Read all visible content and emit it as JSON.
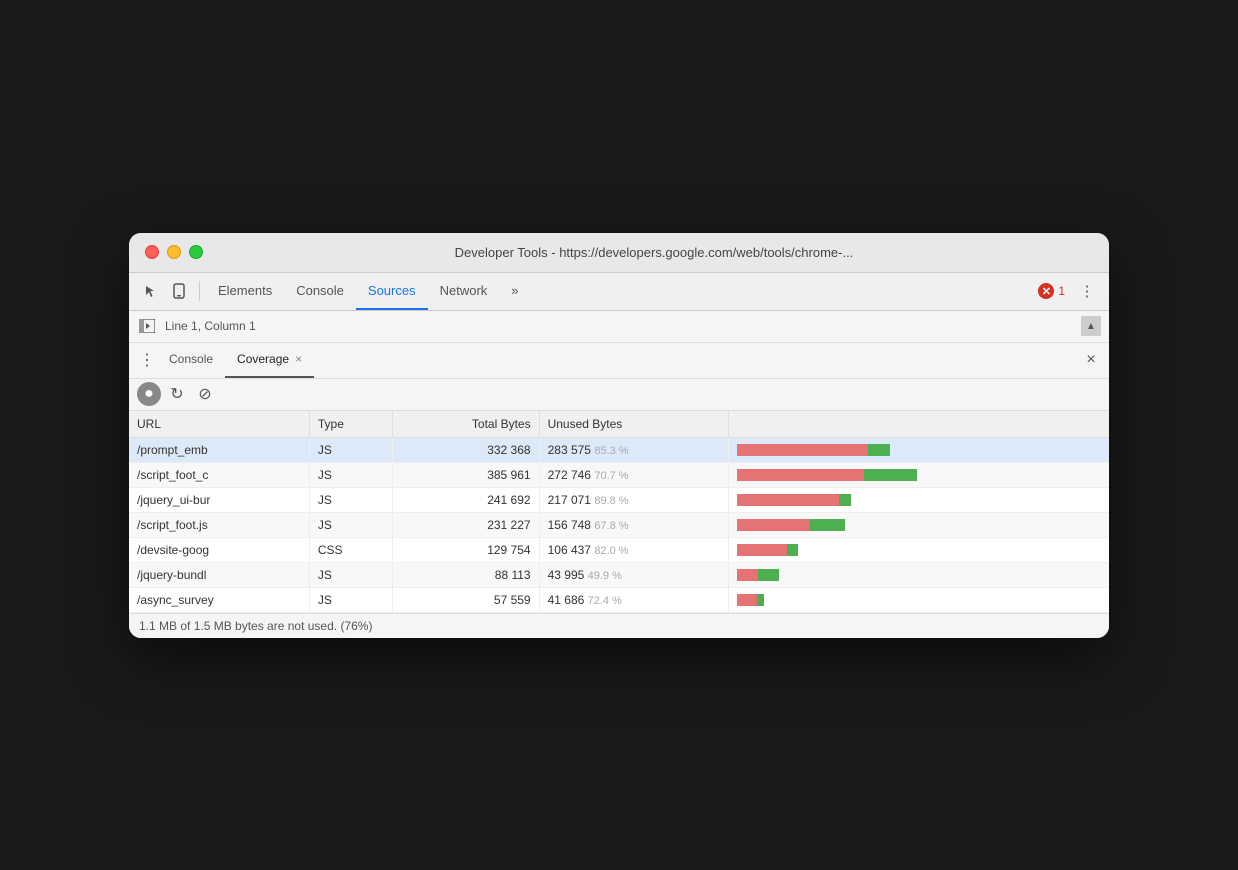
{
  "window": {
    "title": "Developer Tools - https://developers.google.com/web/tools/chrome-...",
    "traffic_lights": [
      "close",
      "minimize",
      "maximize"
    ]
  },
  "devtools": {
    "tabs": [
      {
        "id": "elements",
        "label": "Elements",
        "active": false
      },
      {
        "id": "console",
        "label": "Console",
        "active": false
      },
      {
        "id": "sources",
        "label": "Sources",
        "active": true
      },
      {
        "id": "network",
        "label": "Network",
        "active": false
      },
      {
        "id": "more",
        "label": "»",
        "active": false
      }
    ],
    "error_count": "1",
    "status_line": "Line 1, Column 1"
  },
  "panel": {
    "tabs": [
      {
        "id": "console",
        "label": "Console",
        "active": false,
        "closeable": false
      },
      {
        "id": "coverage",
        "label": "Coverage",
        "active": true,
        "closeable": true
      }
    ]
  },
  "coverage": {
    "toolbar": {
      "record_label": "●",
      "reload_label": "↻",
      "clear_label": "⊘"
    },
    "table": {
      "headers": [
        "URL",
        "Type",
        "Total Bytes",
        "Unused Bytes",
        ""
      ],
      "rows": [
        {
          "url": "/prompt_emb",
          "type": "JS",
          "total_bytes": "332 368",
          "unused_bytes": "283 575",
          "unused_pct": "85.3 %",
          "used_ratio": 0.147,
          "unused_ratio": 0.853,
          "bar_width_pct": 85,
          "selected": true
        },
        {
          "url": "/script_foot_c",
          "type": "JS",
          "total_bytes": "385 961",
          "unused_bytes": "272 746",
          "unused_pct": "70.7 %",
          "used_ratio": 0.293,
          "unused_ratio": 0.707,
          "bar_width_pct": 100,
          "selected": false
        },
        {
          "url": "/jquery_ui-bur",
          "type": "JS",
          "total_bytes": "241 692",
          "unused_bytes": "217 071",
          "unused_pct": "89.8 %",
          "used_ratio": 0.102,
          "unused_ratio": 0.898,
          "bar_width_pct": 63,
          "selected": false
        },
        {
          "url": "/script_foot.js",
          "type": "JS",
          "total_bytes": "231 227",
          "unused_bytes": "156 748",
          "unused_pct": "67.8 %",
          "used_ratio": 0.322,
          "unused_ratio": 0.678,
          "bar_width_pct": 60,
          "selected": false
        },
        {
          "url": "/devsite-goog",
          "type": "CSS",
          "total_bytes": "129 754",
          "unused_bytes": "106 437",
          "unused_pct": "82.0 %",
          "used_ratio": 0.18,
          "unused_ratio": 0.82,
          "bar_width_pct": 34,
          "selected": false
        },
        {
          "url": "/jquery-bundl",
          "type": "JS",
          "total_bytes": "88 113",
          "unused_bytes": "43 995",
          "unused_pct": "49.9 %",
          "used_ratio": 0.501,
          "unused_ratio": 0.499,
          "bar_width_pct": 23,
          "selected": false
        },
        {
          "url": "/async_survey",
          "type": "JS",
          "total_bytes": "57 559",
          "unused_bytes": "41 686",
          "unused_pct": "72.4 %",
          "used_ratio": 0.276,
          "unused_ratio": 0.724,
          "bar_width_pct": 15,
          "selected": false
        }
      ]
    },
    "status": "1.1 MB of 1.5 MB bytes are not used. (76%)"
  },
  "colors": {
    "bar_used": "#4caf50",
    "bar_unused": "#e57373",
    "tab_active_border": "#1a73e8",
    "selected_row_bg": "#dce9f8"
  }
}
